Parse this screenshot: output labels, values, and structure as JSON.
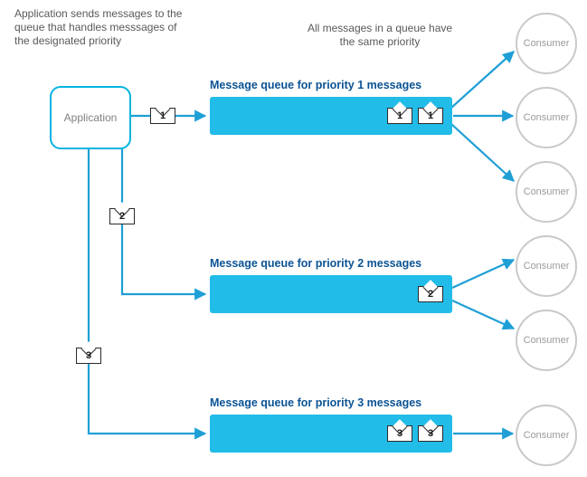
{
  "captions": {
    "app_caption": "Application sends messages to the queue that handles messsages of the designated priority",
    "queue_caption": "All messages in a queue have the same priority"
  },
  "application": {
    "label": "Application"
  },
  "queues": [
    {
      "label": "Message queue for priority 1 messages",
      "priority": "1",
      "items": [
        "1",
        "1"
      ]
    },
    {
      "label": "Message queue for priority 2 messages",
      "priority": "2",
      "items": [
        "2"
      ]
    },
    {
      "label": "Message queue for priority 3 messages",
      "priority": "3",
      "items": [
        "3",
        "3"
      ]
    }
  ],
  "pipe_envelopes": [
    "1",
    "2",
    "3"
  ],
  "consumers": [
    {
      "label": "Consumer"
    },
    {
      "label": "Consumer"
    },
    {
      "label": "Consumer"
    },
    {
      "label": "Consumer"
    },
    {
      "label": "Consumer"
    },
    {
      "label": "Consumer"
    }
  ],
  "colors": {
    "accent": "#1e9fd6",
    "queue_fill": "#22bce8",
    "label_blue": "#0b5394"
  }
}
